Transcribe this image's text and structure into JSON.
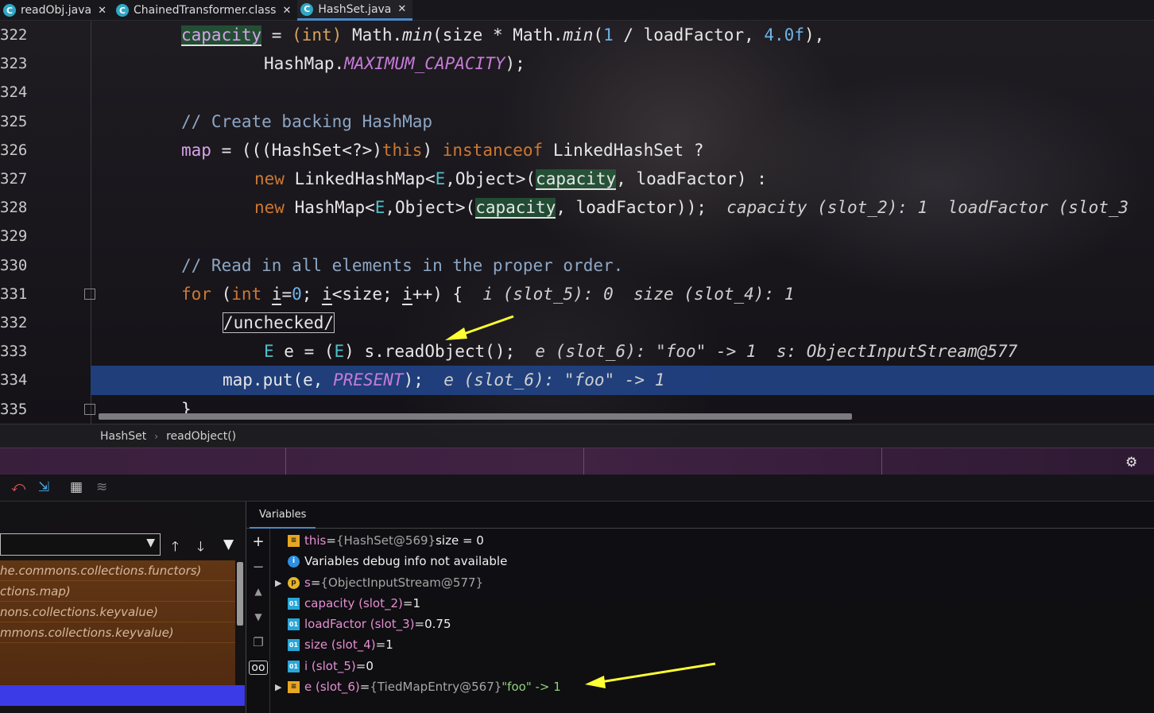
{
  "tabs": [
    {
      "label": "readObj.java",
      "icon": "C"
    },
    {
      "label": "ChainedTransformer.class",
      "icon": "C"
    },
    {
      "label": "HashSet.java",
      "icon": "C",
      "active": true
    }
  ],
  "editor": {
    "lines": [
      {
        "num": "322"
      },
      {
        "num": "323"
      },
      {
        "num": "324"
      },
      {
        "num": "325"
      },
      {
        "num": "326"
      },
      {
        "num": "327"
      },
      {
        "num": "328"
      },
      {
        "num": "329"
      },
      {
        "num": "330"
      },
      {
        "num": "331"
      },
      {
        "num": "332"
      },
      {
        "num": "333"
      },
      {
        "num": "334"
      },
      {
        "num": "335"
      }
    ],
    "tokens": {
      "capacity": "capacity",
      "eq": " = ",
      "int_cast": "(int)",
      "math_min_1": " Math.",
      "min": "min",
      "size_mul": "(size * Math.",
      "one": "1",
      "div_lf": " / loadFactor, ",
      "four": "4.0f",
      "close": "),",
      "hashmap": "HashMap.",
      "max_cap": "MAXIMUM_CAPACITY",
      "semi_close": ");",
      "comment_325": "// Create backing HashMap",
      "map": "map",
      "hashset_cast": " = (((HashSet<?>)",
      "this": "this",
      "close_paren": ")",
      "instanceof": " instanceof",
      "linked_q": " LinkedHashSet ?",
      "new": "new",
      "linked_map": " LinkedHashMap<",
      "E": "E",
      "object_open": ",Object>(",
      "comma_lf": ", loadFactor) :",
      "hashmap2": " HashMap<",
      "lf_close": ", loadFactor));",
      "hint_328": "capacity (slot_2): 1  loadFactor (slot_3",
      "comment_330": "// Read in all elements in the proper order.",
      "for": "for",
      "for_open": " (",
      "int": "int",
      "i": "i",
      "eq0": "=",
      "zero": "0",
      "semi": "; ",
      "lt_size": "<size; ",
      "inc": "++) {",
      "hint_331": "i (slot_5): 0  size (slot_4): 1",
      "unchecked": "/unchecked/",
      "e_decl": " e = (",
      "e_cast_close": ") s.readObject();",
      "hint_333": "e (slot_6): \"foo\" -> 1  s: ObjectInputStream@577",
      "map_put": "map.put(e, ",
      "present": "PRESENT",
      "put_close": ");",
      "hint_334": "e (slot_6): \"foo\" -> 1",
      "brace": "}"
    }
  },
  "breadcrumb": [
    "HashSet",
    "readObject()"
  ],
  "frames": {
    "items": [
      "he.commons.collections.functors)",
      "ctions.map)",
      "nons.collections.keyvalue)",
      "mmons.collections.keyvalue)"
    ]
  },
  "variables": {
    "tab_label": "Variables",
    "rows": [
      {
        "icon": "field",
        "expand": false,
        "name": "this",
        "eq": " = ",
        "type": "{HashSet@569}",
        "val": "  size = 0"
      },
      {
        "icon": "info",
        "expand": false,
        "name": "",
        "eq": "",
        "type": "",
        "val": "Variables debug info not available"
      },
      {
        "icon": "param",
        "expand": true,
        "name": "s",
        "eq": " = ",
        "type": "{ObjectInputStream@577}",
        "val": ""
      },
      {
        "icon": "local",
        "expand": false,
        "name": "capacity (slot_2)",
        "eq": " = ",
        "type": "",
        "val": "1"
      },
      {
        "icon": "local",
        "expand": false,
        "name": "loadFactor (slot_3)",
        "eq": " = ",
        "type": "",
        "val": "0.75"
      },
      {
        "icon": "local",
        "expand": false,
        "name": "size (slot_4)",
        "eq": " = ",
        "type": "",
        "val": "1"
      },
      {
        "icon": "local",
        "expand": false,
        "name": "i (slot_5)",
        "eq": " = ",
        "type": "",
        "val": "0"
      },
      {
        "icon": "field",
        "expand": true,
        "name": "e (slot_6)",
        "eq": " = ",
        "type": "{TiedMapEntry@567}",
        "val": " \"foo\" -> 1"
      }
    ]
  },
  "colors": {
    "accent": "#4a88c7",
    "current_line": "#214283",
    "arrow": "#ffff33"
  }
}
